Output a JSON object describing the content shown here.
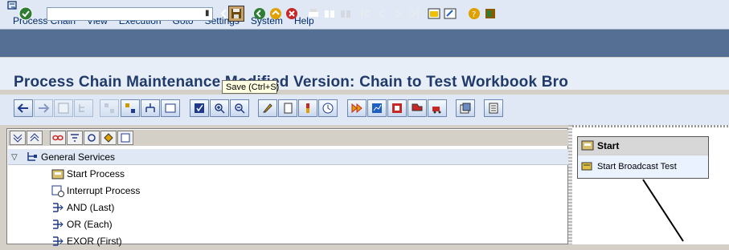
{
  "menu": {
    "items": [
      "Process Chain",
      "View",
      "Execution",
      "Goto",
      "Settings",
      "System",
      "Help"
    ]
  },
  "command_field": {
    "value": ""
  },
  "title": "Process Chain Maintenance Modified Version: Chain to Test Workbook Bro",
  "tooltip": "Save   (Ctrl+S)",
  "tree": {
    "root": "General Services",
    "items": [
      "Start Process",
      "Interrupt Process",
      "AND (Last)",
      "OR (Each)",
      "EXOR (First)"
    ]
  },
  "graph": {
    "start_title": "Start",
    "start_node": "Start Broadcast Test"
  },
  "colors": {
    "menubar_bg": "#dfe8f4",
    "toolbar_bg": "#546e94",
    "title_color": "#1f3a6b",
    "tooltip_bg": "#ffffe1"
  }
}
